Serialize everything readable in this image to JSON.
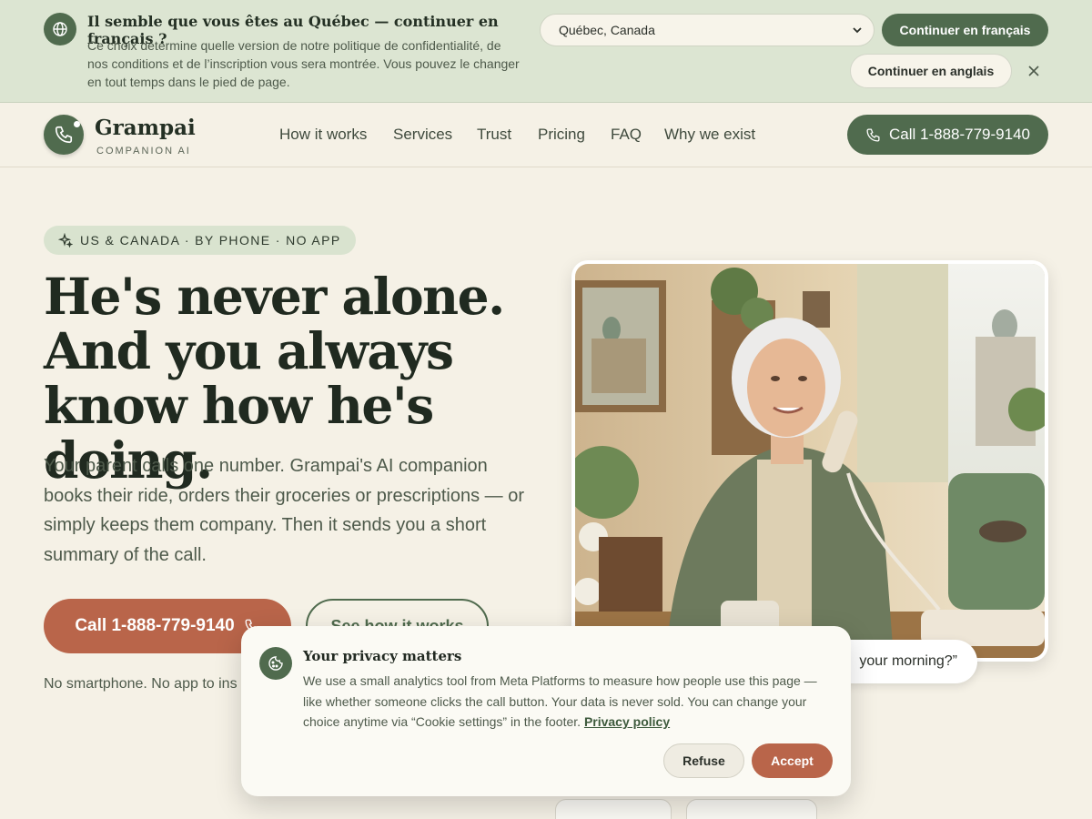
{
  "locale_banner": {
    "title": "Il semble que vous êtes au Québec — continuer en français ?",
    "description": "Ce choix détermine quelle version de notre politique de confidentialité, de nos conditions et de l’inscription vous sera montrée. Vous pouvez le changer en tout temps dans le pied de page.",
    "region_selected": "Québec, Canada",
    "continue_french": "Continuer en français",
    "continue_english": "Continuer en anglais",
    "icon": "globe-icon"
  },
  "nav": {
    "brand": "Grampai",
    "brand_tagline": "COMPANION AI",
    "links": [
      "How it works",
      "Services",
      "Trust",
      "Pricing",
      "FAQ",
      "Why we exist"
    ],
    "call_label": "Call 1-888-779-9140"
  },
  "hero": {
    "pill": "US & CANADA · BY PHONE · NO APP",
    "title": "He's never alone. And you always know how he's doing.",
    "copy": "Your parent calls one number. Grampai's AI companion books their ride, orders their groceries or prescriptions — or simply keeps them company. Then it sends you a short summary of the call.",
    "cta_call": "Call 1-888-779-9140",
    "cta_how": "See how it works",
    "note": "No smartphone. No app to ins",
    "quote": "your morning?”"
  },
  "privacy": {
    "title": "Your privacy matters",
    "body": "We use a small analytics tool from Meta Platforms to measure how people use this page — like whether someone clicks the call button. Your data is never sold. You can change your choice anytime via “Cookie settings” in the footer.",
    "link": "Privacy policy",
    "refuse": "Refuse",
    "accept": "Accept"
  },
  "colors": {
    "brand_green": "#506b4e",
    "accent_terracotta": "#b9654a",
    "background": "#f5f1e6",
    "banner": "#dce5d2"
  }
}
